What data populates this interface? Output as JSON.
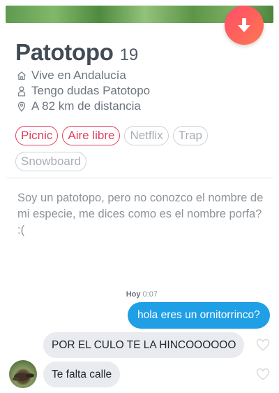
{
  "profile": {
    "name": "Patotopo",
    "age": "19",
    "location": "Vive en Andalucía",
    "job": "Tengo dudas Patotopo",
    "distance": "A 82 km de distancia",
    "bio": "Soy un patotopo, pero no conozco el nombre de mi especie, me dices como es el nombre porfa? :("
  },
  "interests": [
    {
      "label": "Picnic",
      "shared": true
    },
    {
      "label": "Aire libre",
      "shared": true
    },
    {
      "label": "Netflix",
      "shared": false
    },
    {
      "label": "Trap",
      "shared": false
    },
    {
      "label": "Snowboard",
      "shared": false
    }
  ],
  "chat": {
    "timestamp_day": "Hoy",
    "timestamp_time": "0:07",
    "messages": [
      {
        "from": "me",
        "text": "hola eres un ornitorrinco?"
      },
      {
        "from": "them",
        "text": "POR EL CULO TE LA HINCOOOOOO"
      },
      {
        "from": "them",
        "text": "Te falta calle"
      }
    ]
  },
  "icons": {
    "dislike": "arrow-down-icon",
    "location": "home-icon",
    "job": "person-icon",
    "distance": "map-pin-icon",
    "like": "heart-outline-icon"
  },
  "colors": {
    "accent": "#fd5068",
    "bubble_out": "#1e9fe6",
    "bubble_in": "#e9ebee",
    "chip_active": "#e0405e"
  }
}
